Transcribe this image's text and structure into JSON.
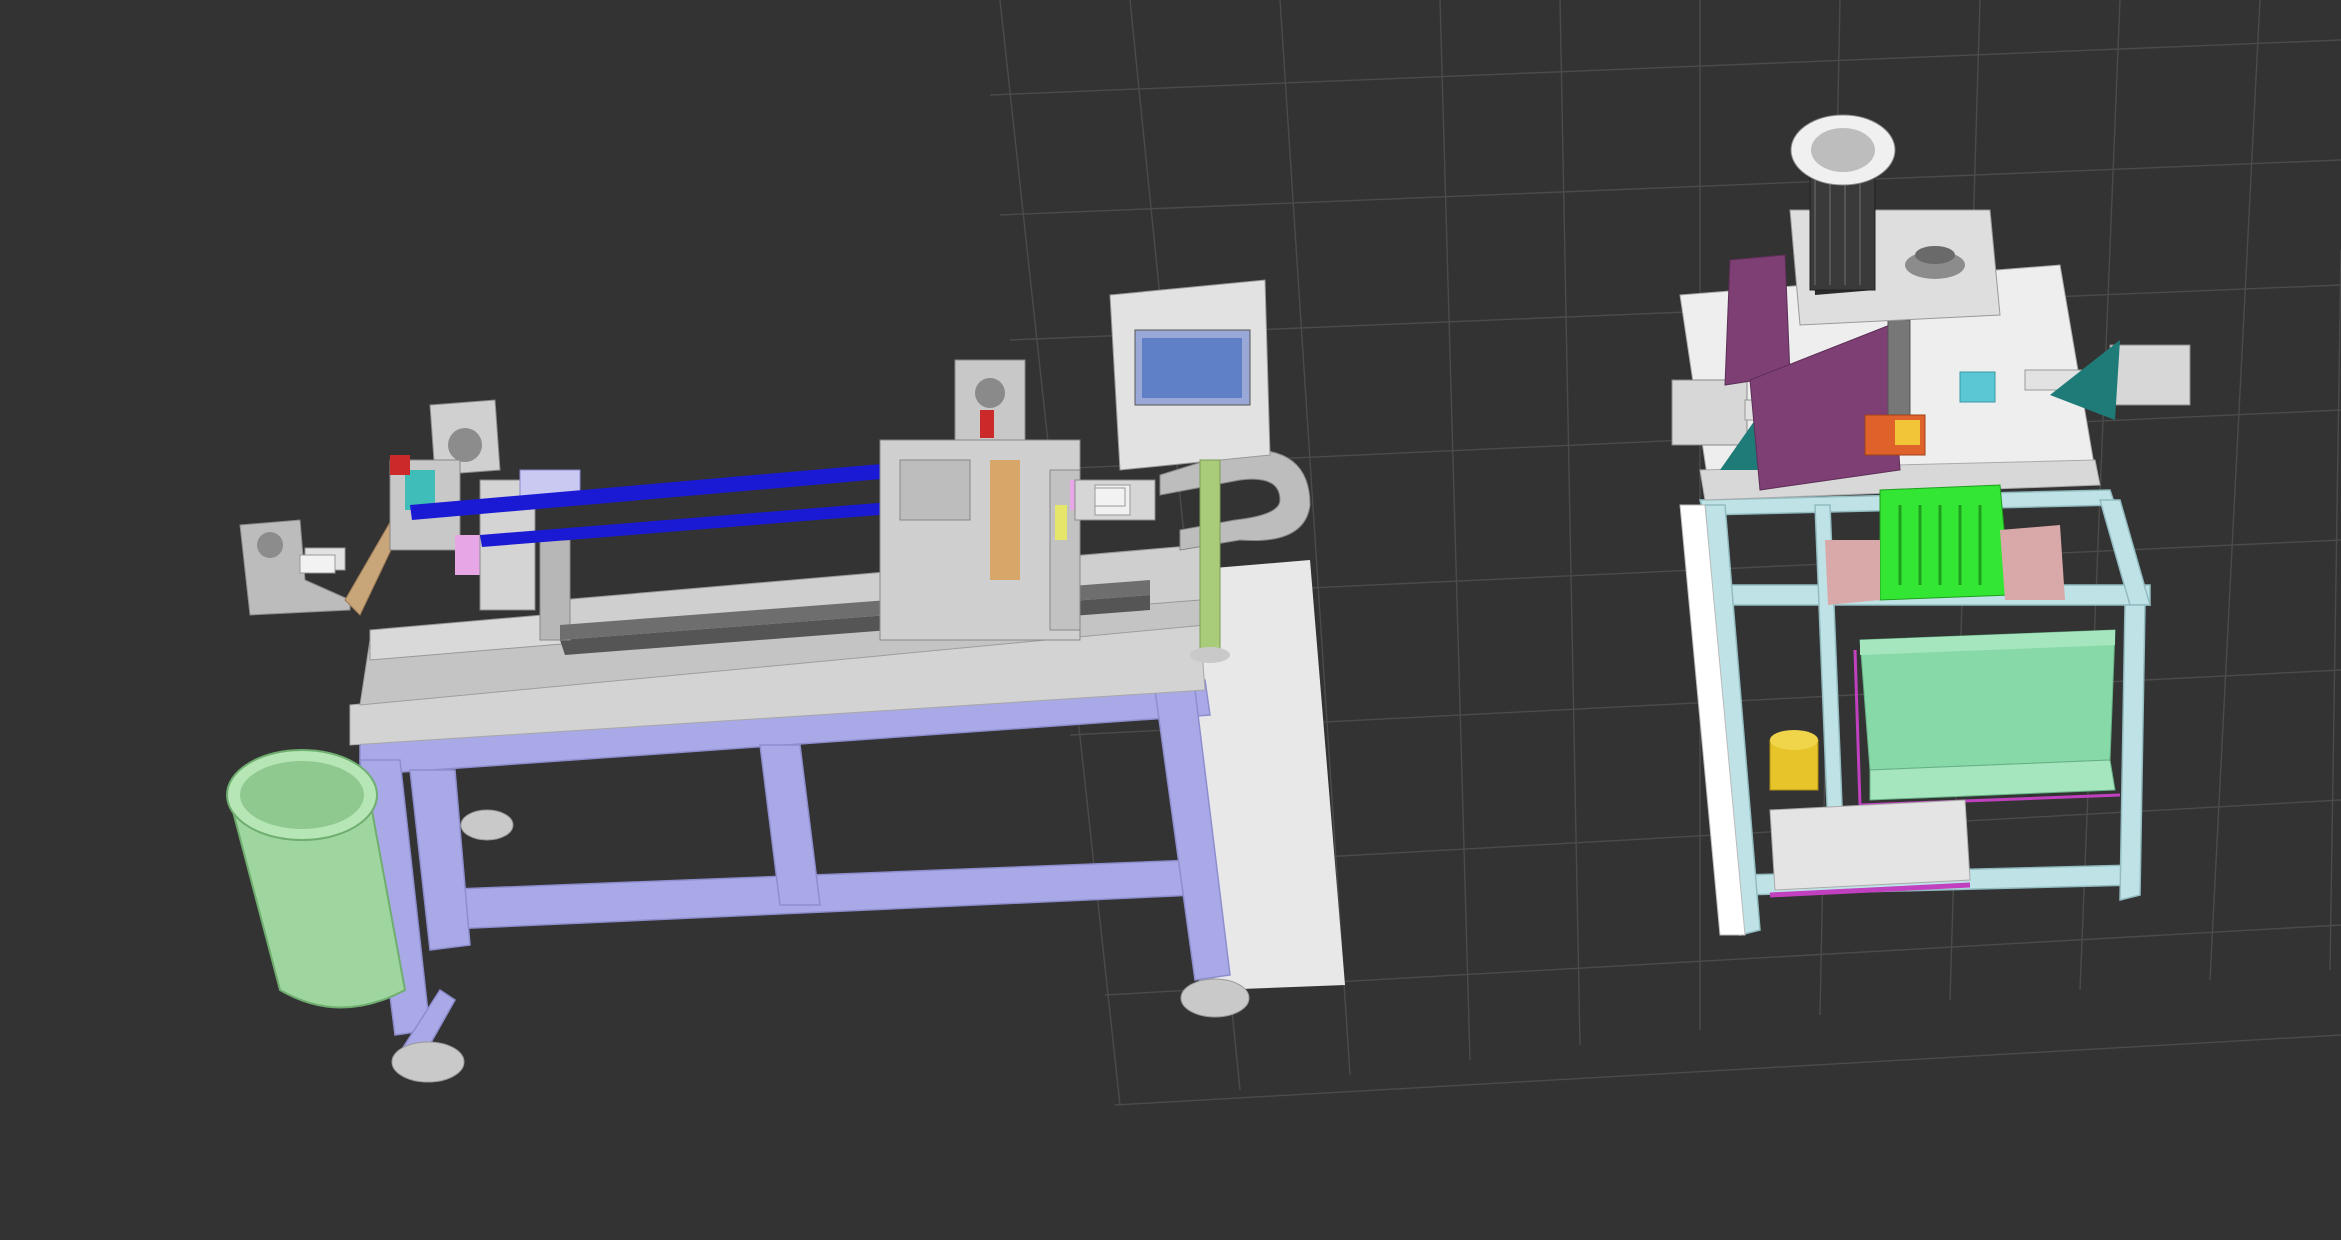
{
  "scene": {
    "background": "#333333",
    "grid_color": "#4a4a4a",
    "objects": [
      {
        "name": "linear-feed-machine",
        "frame_color": "#a9a9e8",
        "rod_color": "#1a1ad4",
        "bin_color": "#a6dca6"
      },
      {
        "name": "motor-cutting-unit",
        "frame_color": "#bfe2e6",
        "panel_color": "#7d3f74",
        "tray_color": "#33e633",
        "bin_color": "#88d9a8"
      }
    ]
  }
}
